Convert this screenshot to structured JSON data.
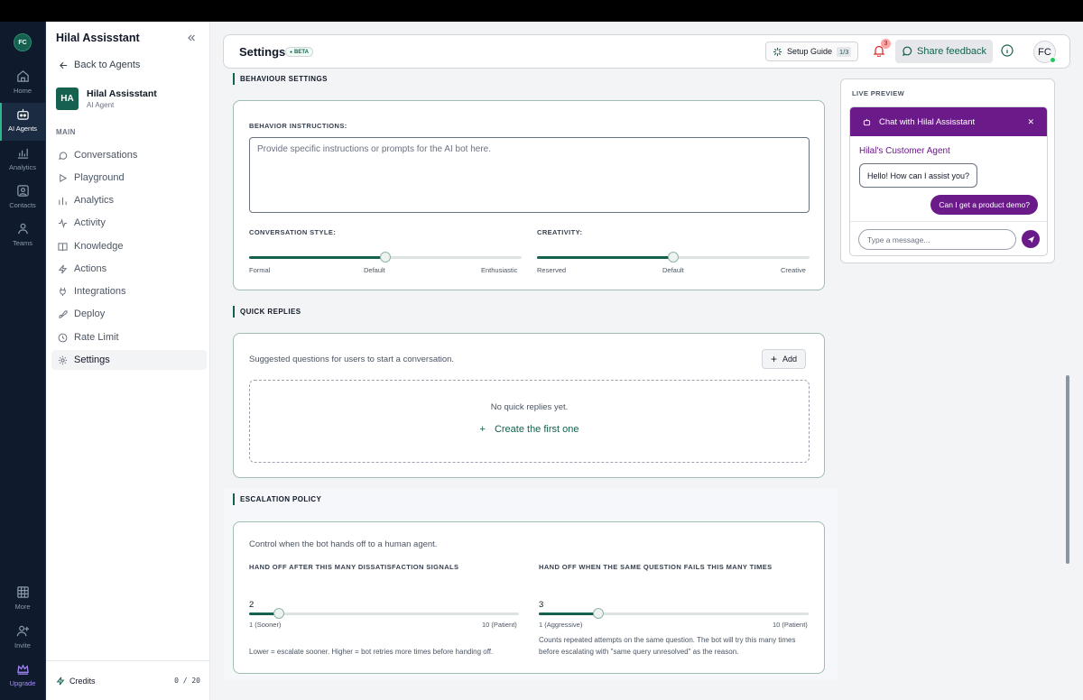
{
  "rail": {
    "logo": "FC",
    "items": [
      {
        "label": "Home",
        "icon": "home-icon"
      },
      {
        "label": "AI Agents",
        "icon": "robot-icon"
      },
      {
        "label": "Analytics",
        "icon": "chart-icon"
      },
      {
        "label": "Contacts",
        "icon": "contacts-icon"
      },
      {
        "label": "Teams",
        "icon": "teams-icon"
      }
    ],
    "bottom": [
      {
        "label": "More",
        "icon": "grid-icon"
      },
      {
        "label": "Invite",
        "icon": "user-plus-icon"
      },
      {
        "label": "Upgrade",
        "icon": "crown-icon"
      }
    ]
  },
  "sidebar": {
    "title": "Hilal Assisstant",
    "back": "Back to Agents",
    "agent": {
      "initials": "HA",
      "name": "Hilal Assisstant",
      "role": "AI Agent"
    },
    "section": "MAIN",
    "items": [
      {
        "label": "Conversations"
      },
      {
        "label": "Playground"
      },
      {
        "label": "Analytics"
      },
      {
        "label": "Activity"
      },
      {
        "label": "Knowledge"
      },
      {
        "label": "Actions"
      },
      {
        "label": "Integrations"
      },
      {
        "label": "Deploy"
      },
      {
        "label": "Rate Limit"
      },
      {
        "label": "Settings"
      }
    ],
    "credits_label": "Credits",
    "credits_value": "0 / 20"
  },
  "header": {
    "title": "Settings",
    "beta": "BETA",
    "setup_label": "Setup Guide",
    "setup_count": "1/3",
    "notifications": "3",
    "share": "Share feedback",
    "avatar": "FC"
  },
  "behaviour": {
    "section": "BEHAVIOUR SETTINGS",
    "instructions_label": "BEHAVIOR INSTRUCTIONS:",
    "instructions_placeholder": "Provide specific instructions or prompts for the AI bot here.",
    "style_label": "CONVERSATION STYLE:",
    "style_ticks": [
      "Formal",
      "Default",
      "Enthusiastic"
    ],
    "style_value": 0.5,
    "creativity_label": "CREATIVITY:",
    "creativity_ticks": [
      "Reserved",
      "Default",
      "Creative"
    ],
    "creativity_value": 0.5
  },
  "quick_replies": {
    "section": "QUICK REPLIES",
    "description": "Suggested questions for users to start a conversation.",
    "add": "Add",
    "empty": "No quick replies yet.",
    "create": "Create the first one"
  },
  "escalation": {
    "section": "ESCALATION POLICY",
    "description": "Control when the bot hands off to a human agent.",
    "signals": {
      "label": "HAND OFF AFTER THIS MANY DISSATISFACTION SIGNALS",
      "value": 2,
      "min": 1,
      "max": 10,
      "min_label": "1 (Sooner)",
      "max_label": "10 (Patient)",
      "note": "Lower = escalate sooner. Higher = bot retries more times before handing off."
    },
    "repeats": {
      "label": "HAND OFF WHEN THE SAME QUESTION FAILS THIS MANY TIMES",
      "value": 3,
      "min": 1,
      "max": 10,
      "min_label": "1 (Aggressive)",
      "max_label": "10 (Patient)",
      "note": "Counts repeated attempts on the same question. The bot will try this many times before escalating with \"same query unresolved\" as the reason."
    }
  },
  "preview": {
    "label": "LIVE PREVIEW",
    "chat_title": "Chat with Hilal Assisstant",
    "agent_name": "Hilal's Customer Agent",
    "bot_message": "Hello! How can I assist you?",
    "user_message": "Can I get a product demo?",
    "input_placeholder": "Type a message..."
  },
  "colors": {
    "brand": "#16604f",
    "chat": "#6b1a8a",
    "rail": "#0f1b2d"
  }
}
